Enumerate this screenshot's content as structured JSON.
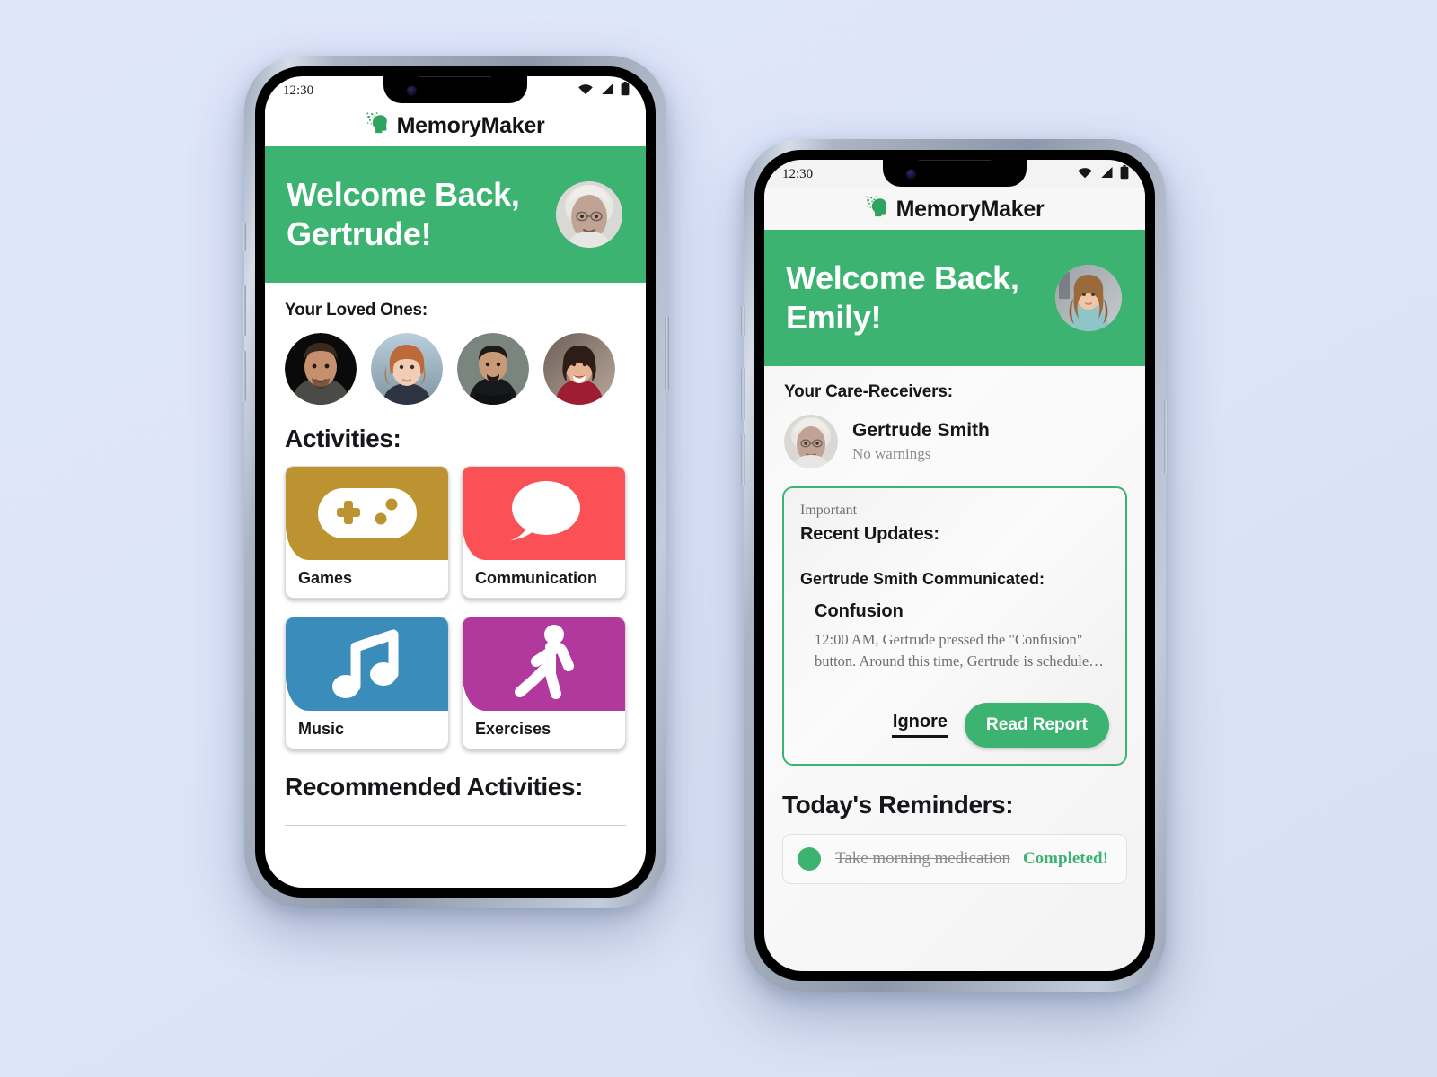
{
  "theme": {
    "brand_green": "#3cb371",
    "page_background": "#dde5fa",
    "card_games": "#bd9231",
    "card_communication": "#fb5055",
    "card_music": "#3a8dbb",
    "card_exercises": "#b1399d"
  },
  "phone_left": {
    "status": {
      "time": "12:30",
      "wifi_icon": "wifi-icon",
      "signal_icon": "signal-icon",
      "battery_icon": "battery-icon"
    },
    "appbar": {
      "logo_icon": "memorymaker-logo-icon",
      "title": "MemoryMaker"
    },
    "hero": {
      "greeting_line1": "Welcome Back,",
      "greeting_line2": "Gertrude!",
      "avatar_alt": "Gertrude avatar"
    },
    "loved_ones": {
      "label": "Your Loved Ones:",
      "people": [
        {
          "id": "loved-one-1",
          "alt": "young man dark hair"
        },
        {
          "id": "loved-one-2",
          "alt": "woman auburn bob"
        },
        {
          "id": "loved-one-3",
          "alt": "man in black hoodie"
        },
        {
          "id": "loved-one-4",
          "alt": "woman in red top"
        }
      ]
    },
    "activities": {
      "title": "Activities:",
      "cards": [
        {
          "id": "games",
          "label": "Games",
          "color": "#bd9231",
          "icon": "gamepad-icon"
        },
        {
          "id": "communication",
          "label": "Communication",
          "color": "#fb5055",
          "icon": "speech-bubble-icon"
        },
        {
          "id": "music",
          "label": "Music",
          "color": "#3a8dbb",
          "icon": "music-note-icon"
        },
        {
          "id": "exercises",
          "label": "Exercises",
          "color": "#b1399d",
          "icon": "walking-person-icon"
        }
      ]
    },
    "recommended": {
      "title": "Recommended Activities:"
    }
  },
  "phone_right": {
    "status": {
      "time": "12:30",
      "wifi_icon": "wifi-icon",
      "signal_icon": "signal-icon",
      "battery_icon": "battery-icon"
    },
    "appbar": {
      "logo_icon": "memorymaker-logo-icon",
      "title": "MemoryMaker"
    },
    "hero": {
      "greeting_line1": "Welcome Back,",
      "greeting_line2": "Emily!",
      "avatar_alt": "Emily avatar"
    },
    "care_receivers": {
      "label": "Your Care-Receivers:",
      "people": [
        {
          "name": "Gertrude Smith",
          "status": "No warnings",
          "avatar_alt": "Gertrude Smith avatar"
        }
      ]
    },
    "important_card": {
      "kicker": "Important",
      "heading": "Recent Updates:",
      "subject": "Gertrude Smith Communicated:",
      "item_title": "Confusion",
      "item_body": "12:00 AM, Gertrude pressed the \"Confusion\" button. Around this time, Gertrude is schedule…",
      "ignore_label": "Ignore",
      "read_report_label": "Read Report"
    },
    "reminders": {
      "title": "Today's Reminders:",
      "items": [
        {
          "text": "Take morning medication",
          "status": "Completed!",
          "done": true
        }
      ]
    }
  }
}
